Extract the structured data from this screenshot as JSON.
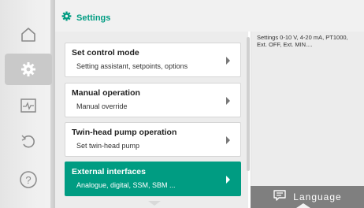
{
  "header": {
    "title": "Settings"
  },
  "sidebar": {
    "items": [
      {
        "icon": "home-icon"
      },
      {
        "icon": "gear-icon"
      },
      {
        "icon": "diagnostics-icon"
      },
      {
        "icon": "undo-icon"
      },
      {
        "icon": "help-icon"
      }
    ]
  },
  "menu": {
    "items": [
      {
        "title": "Set control mode",
        "subtitle": "Setting assistant, setpoints, options"
      },
      {
        "title": "Manual operation",
        "subtitle": "Manual override"
      },
      {
        "title": "Twin-head pump operation",
        "subtitle": "Set twin-head pump"
      },
      {
        "title": "External interfaces",
        "subtitle": "Analogue, digital, SSM, SBM ..."
      }
    ]
  },
  "info_panel": {
    "text": "Settings 0-10 V, 4-20 mA, PT1000, Ext. OFF, Ext. MIN...."
  },
  "language_button": {
    "label": "Language"
  },
  "colors": {
    "accent": "#009c82",
    "language_bg": "#7f7f7f"
  }
}
